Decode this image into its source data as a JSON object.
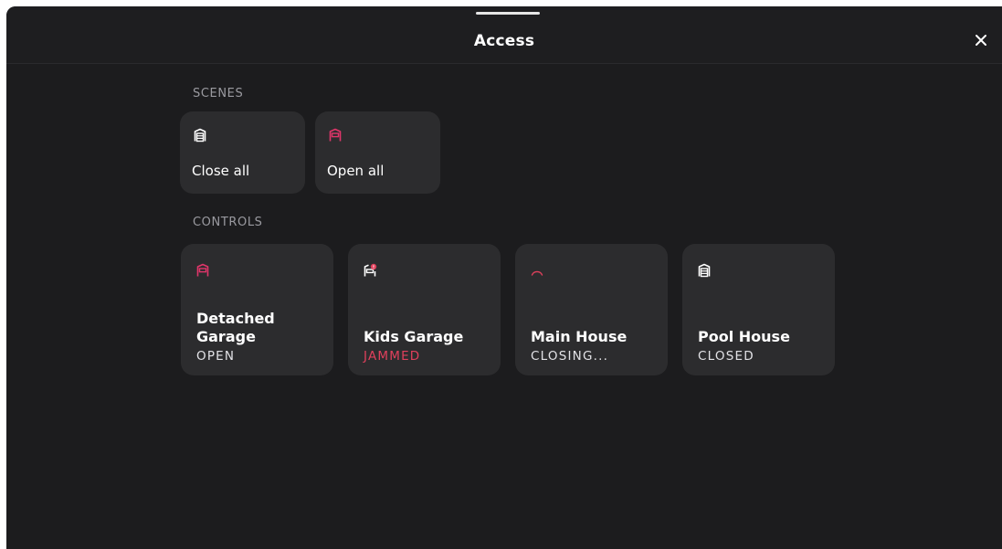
{
  "header": {
    "title": "Access",
    "close_icon": "close-icon"
  },
  "scenes": {
    "label": "SCENES",
    "items": [
      {
        "label": "Close all",
        "icon": "garage-closed-icon",
        "icon_color": "#ffffff"
      },
      {
        "label": "Open all",
        "icon": "garage-open-icon",
        "icon_color": "#e0366a"
      }
    ]
  },
  "controls": {
    "label": "CONTROLS",
    "items": [
      {
        "name": "Detached Garage",
        "status": "OPEN",
        "icon": "garage-open-icon",
        "icon_color": "#e0366a"
      },
      {
        "name": "Kids Garage",
        "status": "JAMMED",
        "icon": "garage-alert-icon",
        "icon_color": "#e0405c"
      },
      {
        "name": "Main House",
        "status": "CLOSING...",
        "icon": "loading-spinner-icon",
        "icon_color": "#e0405c"
      },
      {
        "name": "Pool House",
        "status": "CLOSED",
        "icon": "garage-closed-icon",
        "icon_color": "#ffffff"
      }
    ]
  },
  "colors": {
    "background": "#1c1c1e",
    "card": "#2c2c2e",
    "accent": "#e0366a",
    "alert": "#e0405c"
  }
}
